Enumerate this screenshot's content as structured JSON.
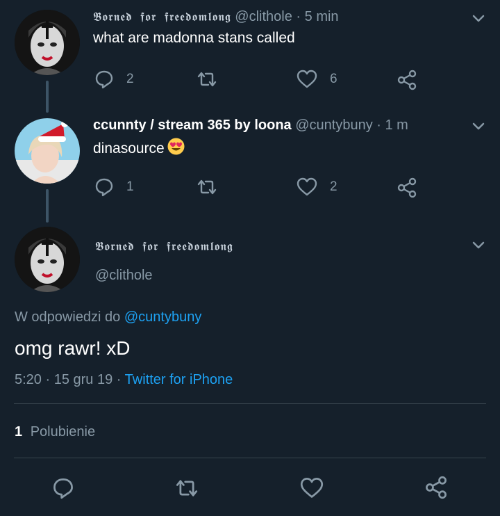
{
  "tweets": [
    {
      "display_name": "𝕭𝖔𝖗𝖓𝖊𝖉 𝖋𝖔𝖗 𝖋𝖗𝖊𝖊𝖉𝖔𝖒𝖑𝖔𝖓𝖌",
      "handle": "@clithole",
      "time": "· 5 min",
      "text": "what are madonna stans called",
      "replies": "2",
      "retweets": "",
      "likes": "6"
    },
    {
      "display_name": "ccunnty / stream 365 by loona",
      "handle": "@cuntybuny",
      "time": "· 1 m",
      "text": "dinasource",
      "emoji": "heart-eyes-emoji",
      "replies": "1",
      "retweets": "",
      "likes": "2"
    }
  ],
  "main_tweet": {
    "display_name": "𝕭𝖔𝖗𝖓𝖊𝖉 𝖋𝖔𝖗 𝖋𝖗𝖊𝖊𝖉𝖔𝖒𝖑𝖔𝖓𝖌",
    "handle": "@clithole",
    "reply_prefix": "W odpowiedzi do",
    "reply_to": "@cuntybuny",
    "text": "omg rawr! xD",
    "time": "5:20",
    "date": "· 15 gru 19 ·",
    "source": "Twitter for iPhone",
    "likes_count": "1",
    "likes_label": "Polubienie"
  },
  "icons": [
    "reply-icon",
    "retweet-icon",
    "like-icon",
    "share-icon",
    "chevron-down-icon"
  ],
  "colors": {
    "background": "#15202b",
    "muted": "#8899a6",
    "link": "#1da1f2",
    "divider": "#38444d"
  }
}
